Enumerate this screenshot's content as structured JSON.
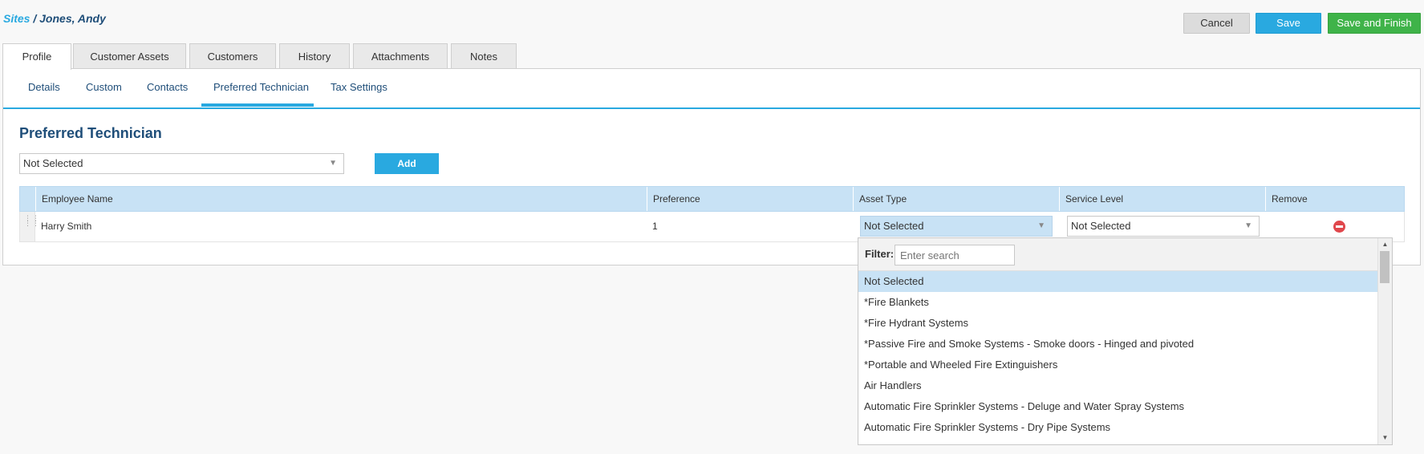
{
  "breadcrumb": {
    "parent": "Sites",
    "separator": " / ",
    "current": "Jones, Andy"
  },
  "actions": {
    "cancel": "Cancel",
    "save": "Save",
    "save_finish": "Save and Finish"
  },
  "tabs": [
    "Profile",
    "Customer Assets",
    "Customers",
    "History",
    "Attachments",
    "Notes"
  ],
  "active_tab": "Profile",
  "subtabs": [
    "Details",
    "Custom",
    "Contacts",
    "Preferred Technician",
    "Tax Settings"
  ],
  "active_subtab": "Preferred Technician",
  "section": {
    "title": "Preferred Technician",
    "technician_select": "Not Selected",
    "add_label": "Add"
  },
  "grid": {
    "columns": [
      "Employee Name",
      "Preference",
      "Asset Type",
      "Service Level",
      "Remove"
    ],
    "rows": [
      {
        "employee": "Harry Smith",
        "preference": "1",
        "asset_type": "Not Selected",
        "service_level": "Not Selected"
      }
    ]
  },
  "dropdown": {
    "filter_label": "Filter:",
    "filter_placeholder": "Enter search",
    "options": [
      "Not Selected",
      "*Fire Blankets",
      "*Fire Hydrant Systems",
      "*Passive Fire and Smoke Systems - Smoke doors - Hinged and pivoted",
      "*Portable and Wheeled Fire Extinguishers",
      "Air Handlers",
      "Automatic Fire Sprinkler Systems - Deluge and Water Spray Systems",
      "Automatic Fire Sprinkler Systems - Dry Pipe Systems"
    ],
    "selected": "Not Selected"
  },
  "colors": {
    "accent": "#29a9e0",
    "title": "#1f4e79",
    "save_finish": "#3fb349",
    "header_bg": "#c8e2f5",
    "remove": "#e0474c"
  }
}
